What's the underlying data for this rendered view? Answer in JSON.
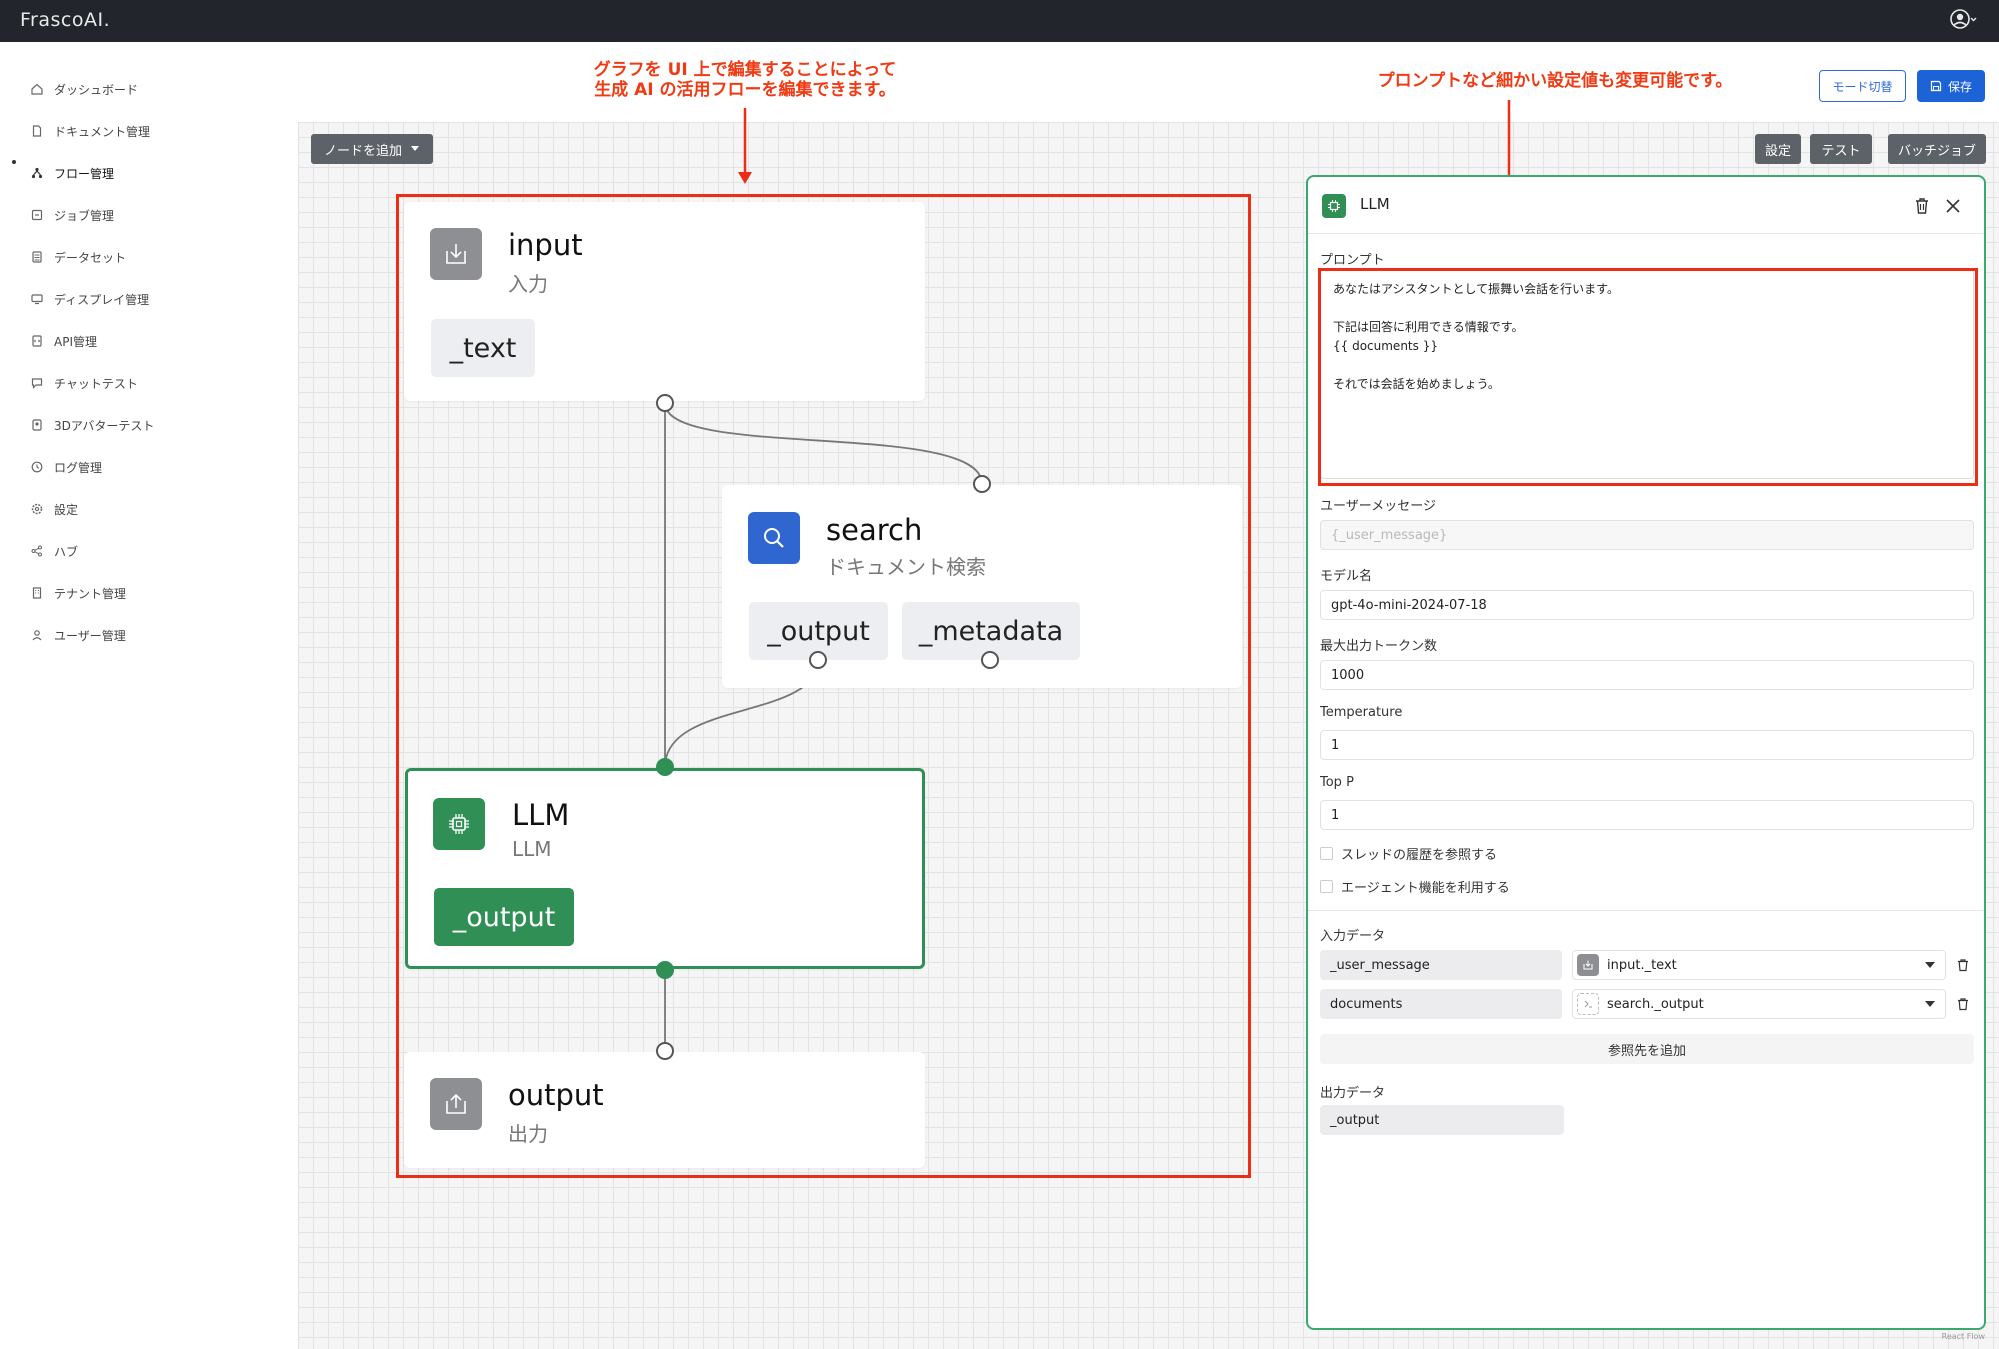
{
  "app": {
    "logo": "FrascoAI."
  },
  "sidebar": {
    "items": [
      {
        "label": "ダッシュボード",
        "icon": "home-icon"
      },
      {
        "label": "ドキュメント管理",
        "icon": "document-icon"
      },
      {
        "label": "フロー管理",
        "icon": "flow-icon",
        "active": true
      },
      {
        "label": "ジョブ管理",
        "icon": "job-icon"
      },
      {
        "label": "データセット",
        "icon": "dataset-icon"
      },
      {
        "label": "ディスプレイ管理",
        "icon": "display-icon"
      },
      {
        "label": "API管理",
        "icon": "api-icon"
      },
      {
        "label": "チャットテスト",
        "icon": "chat-icon"
      },
      {
        "label": "3Dアバターテスト",
        "icon": "avatar-icon"
      },
      {
        "label": "ログ管理",
        "icon": "clock-icon"
      },
      {
        "label": "設定",
        "icon": "gear-icon"
      },
      {
        "label": "ハブ",
        "icon": "share-icon"
      },
      {
        "label": "テナント管理",
        "icon": "building-icon"
      },
      {
        "label": "ユーザー管理",
        "icon": "user-icon"
      }
    ]
  },
  "header": {
    "mode_switch": "モード切替",
    "save": "保存"
  },
  "toolbar": {
    "add_node": "ノードを追加",
    "settings": "設定",
    "test": "テスト",
    "batch_job": "バッチジョブ"
  },
  "annotations": {
    "left_line1": "グラフを UI 上で編集することによって",
    "left_line2": "生成 AI の活用フローを編集できます。",
    "right": "プロンプトなど細かい設定値も変更可能です。",
    "color": "#ee2d17"
  },
  "nodes": {
    "input": {
      "title": "input",
      "subtitle": "入力",
      "ports": [
        "_text"
      ]
    },
    "search": {
      "title": "search",
      "subtitle": "ドキュメント検索",
      "ports": [
        "_output",
        "_metadata"
      ]
    },
    "llm": {
      "title": "LLM",
      "subtitle": "LLM",
      "ports": [
        "_output"
      ]
    },
    "output": {
      "title": "output",
      "subtitle": "出力"
    }
  },
  "colors": {
    "llm_green": "#2f8f55",
    "search_blue": "#2f66d0",
    "io_gray": "#8e8f93",
    "primary": "#1d63d8"
  },
  "panel": {
    "title": "LLM",
    "prompt_label": "プロンプト",
    "prompt_text": "あなたはアシスタントとして振舞い会話を行います。\n\n下記は回答に利用できる情報です。\n{{ documents }}\n\nそれでは会話を始めましょう。",
    "user_message_label": "ユーザーメッセージ",
    "user_message_placeholder": "{_user_message}",
    "model_label": "モデル名",
    "model_value": "gpt-4o-mini-2024-07-18",
    "max_tokens_label": "最大出力トークン数",
    "max_tokens_value": "1000",
    "temperature_label": "Temperature",
    "temperature_value": "1",
    "top_p_label": "Top P",
    "top_p_value": "1",
    "thread_history_label": "スレッドの履歴を参照する",
    "agent_label": "エージェント機能を利用する",
    "input_data_label": "入力データ",
    "inputs": [
      {
        "name": "_user_message",
        "source": "input._text"
      },
      {
        "name": "documents",
        "source": "search._output"
      }
    ],
    "add_reference": "参照先を追加",
    "output_data_label": "出力データ",
    "output_value": "_output"
  },
  "footer": {
    "attribution": "React Flow"
  }
}
